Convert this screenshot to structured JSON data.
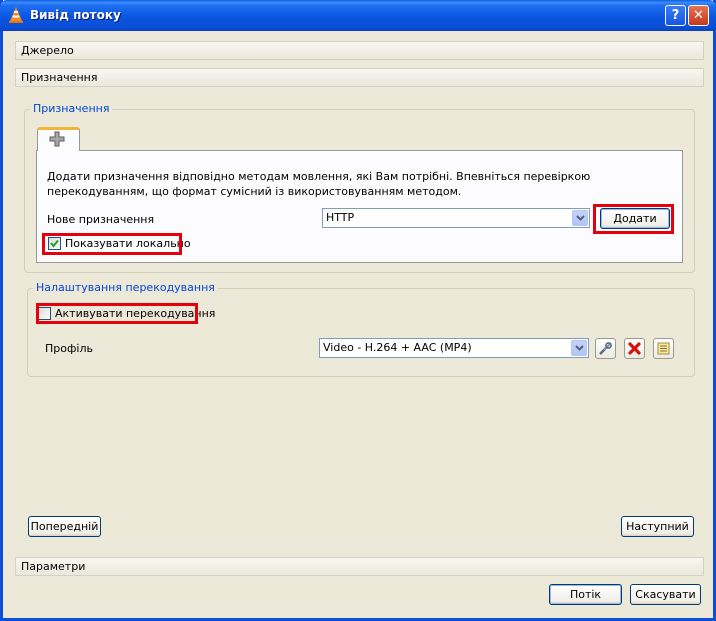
{
  "window": {
    "title": "Вивід потоку",
    "help_label": "?",
    "close_label": "✕"
  },
  "bars": {
    "source": "Джерело",
    "destination": "Призначення",
    "options": "Параметри"
  },
  "destinations_group": {
    "title": "Призначення",
    "add_tab_icon": "plus-icon",
    "description": "Додати призначення відповідно методам мовлення, які Вам потрібні. Впевніться перевіркою перекодуванням, що формат сумісний із використовуванням методом.",
    "new_destination_label": "Нове призначення",
    "method_value": "HTTP",
    "add_button": "Додати",
    "display_locally_label": "Показувати локально",
    "display_locally_checked": true
  },
  "transcode_group": {
    "title": "Налаштування перекодування",
    "activate_label": "Активувати перекодування",
    "activate_checked": false,
    "profile_label": "Профіль",
    "profile_value": "Video - H.264 + AAC (MP4)",
    "icons": [
      "wrench-icon",
      "delete-icon",
      "new-profile-icon"
    ]
  },
  "navigation": {
    "back_button": "Попередній",
    "next_button": "Наступний"
  },
  "footer": {
    "stream_button": "Потік",
    "cancel_button": "Скасувати"
  },
  "colors": {
    "title_bar": "#0a55e2",
    "highlight": "#e5000b",
    "group_title": "#0046d5",
    "dialog_bg": "#ece9d8"
  }
}
